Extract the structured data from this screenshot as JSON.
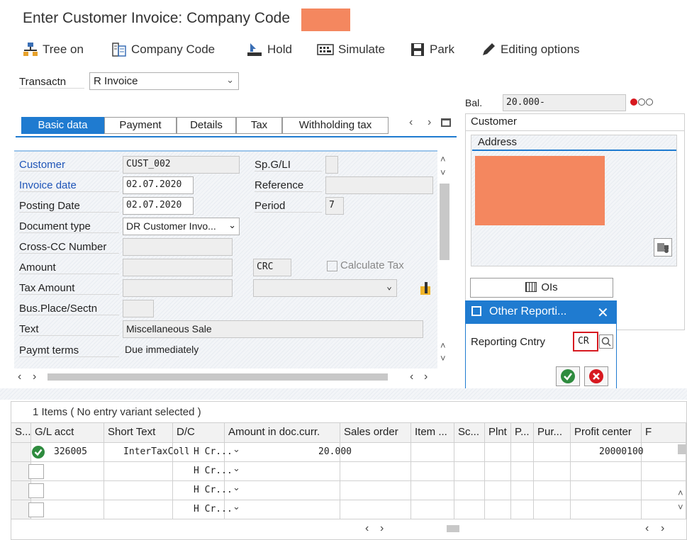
{
  "title": "Enter Customer Invoice: Company Code",
  "toolbar": {
    "tree_on": "Tree on",
    "company_code": "Company Code",
    "hold": "Hold",
    "simulate": "Simulate",
    "park": "Park",
    "editing_options": "Editing options"
  },
  "transaction": {
    "label": "Transactn",
    "value": "R Invoice"
  },
  "balance": {
    "label": "Bal.",
    "value": "20.000-"
  },
  "tabs": [
    {
      "label": "Basic data",
      "active": true
    },
    {
      "label": "Payment"
    },
    {
      "label": "Details"
    },
    {
      "label": "Tax"
    },
    {
      "label": "Withholding tax"
    }
  ],
  "form": {
    "customer_label": "Customer",
    "customer_value": "CUST_002",
    "invoice_date_label": "Invoice date",
    "invoice_date_value": "02.07.2020",
    "posting_date_label": "Posting Date",
    "posting_date_value": "02.07.2020",
    "document_type_label": "Document type",
    "document_type_value": "DR Customer Invo...",
    "cross_cc_label": "Cross-CC Number",
    "amount_label": "Amount",
    "currency": "CRC",
    "calculate_tax": "Calculate Tax",
    "tax_amount_label": "Tax Amount",
    "bus_place_label": "Bus.Place/Sectn",
    "text_label": "Text",
    "text_value": "Miscellaneous Sale",
    "paymt_terms_label": "Paymt terms",
    "paymt_terms_value": "Due immediately",
    "spgl_label": "Sp.G/LI",
    "reference_label": "Reference",
    "period_label": "Period",
    "period_value": "7"
  },
  "customer_panel": {
    "title": "Customer",
    "address_title": "Address",
    "ois_button": "OIs"
  },
  "dialog": {
    "title": "Other Reporti...",
    "reporting_label": "Reporting Cntry",
    "reporting_value": "CR"
  },
  "items": {
    "summary": "1 Items ( No entry variant selected )",
    "columns": [
      "S...",
      "G/L acct",
      "Short Text",
      "D/C",
      "Amount in doc.curr.",
      "Sales order",
      "Item ...",
      "Sc...",
      "Plnt",
      "P...",
      "Pur...",
      "Profit center",
      "F"
    ],
    "rows": [
      {
        "gl": "326005",
        "short_text": "InterTaxColl...",
        "dc": "H Cr...",
        "amount": "20.000",
        "profit_center": "20000100"
      },
      {
        "gl": "",
        "short_text": "",
        "dc": "H Cr...",
        "amount": "",
        "profit_center": ""
      },
      {
        "gl": "",
        "short_text": "",
        "dc": "H Cr...",
        "amount": "",
        "profit_center": ""
      },
      {
        "gl": "",
        "short_text": "",
        "dc": "H Cr...",
        "amount": "",
        "profit_center": ""
      }
    ]
  },
  "colors": {
    "accent": "#1f7bd0",
    "redacted": "#f4875f",
    "status_red": "#d71920",
    "ok_green": "#2e8b3e"
  }
}
